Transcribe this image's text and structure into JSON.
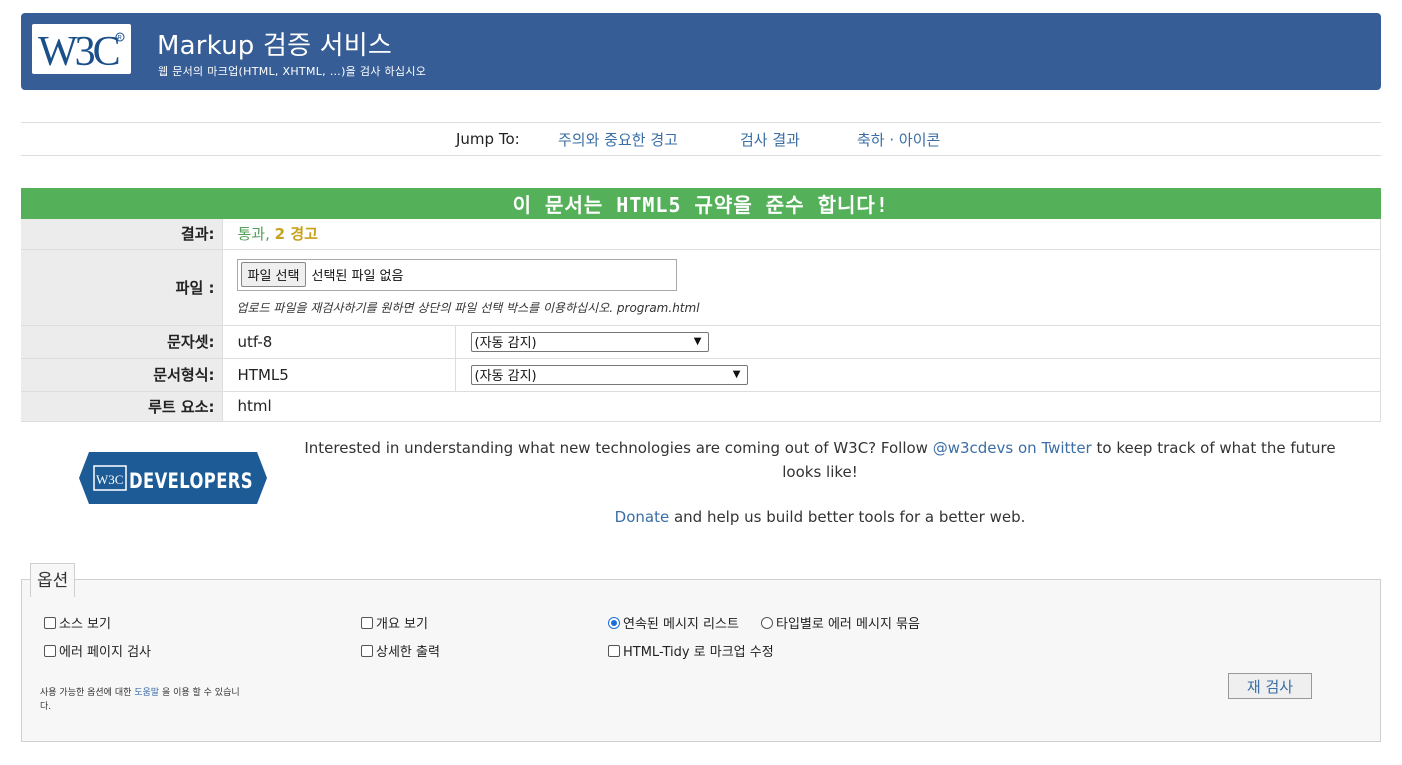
{
  "banner": {
    "logo_text": "W3C",
    "title": "Markup 검증 서비스",
    "subtitle": "웹 문서의 마크업(HTML, XHTML, …)을 검사 하십시오"
  },
  "jump": {
    "label": "Jump To:",
    "links": [
      "주의와 중요한 경고",
      "검사 결과",
      "축하 · 아이콘"
    ]
  },
  "result": {
    "header": "이 문서는 HTML5 규약을 준수 합니다!",
    "rows": {
      "result_label": "결과:",
      "result_pass": "통과,",
      "result_warn": "2 경고",
      "file_label": "파일 :",
      "file_button": "파일 선택",
      "file_status": "선택된 파일 없음",
      "file_hint": "업로드 파일을 재검사하기를 원하면 상단의 파일 선택 박스를 이용하십시오. program.html",
      "charset_label": "문자셋:",
      "charset_value": "utf-8",
      "charset_select": "(자동 감지)",
      "doctype_label": "문서형식:",
      "doctype_value": "HTML5",
      "doctype_select": "(자동 감지)",
      "root_label": "루트 요소:",
      "root_value": "html"
    }
  },
  "promo": {
    "dev_logo_text": "DEVELOPERS",
    "text_before": "Interested in understanding what new technologies are coming out of W3C? Follow ",
    "link": "@w3cdevs on Twitter",
    "text_after": " to keep track of what the future looks like!",
    "donate_link": "Donate",
    "donate_text": " and help us build better tools for a better web."
  },
  "options": {
    "legend": "옵션",
    "show_source": "소스 보기",
    "show_outline": "개요 보기",
    "list_sequential": "연속된 메시지 리스트",
    "group_by_type": "타입별로 에러 메시지 묶음",
    "error_page": "에러 페이지 검사",
    "verbose": "상세한 출력",
    "tidy": "HTML-Tidy 로 마크업 수정",
    "help_before": "사용 가능한 옵션에 대한 ",
    "help_link": "도움말",
    "help_after": " 을 이용 할 수 있습니다.",
    "recheck_button": "재 검사"
  },
  "colors": {
    "banner": "#365d95",
    "pass": "#55b05a",
    "link": "#3a6ea5",
    "warning": "#c8a21c"
  }
}
